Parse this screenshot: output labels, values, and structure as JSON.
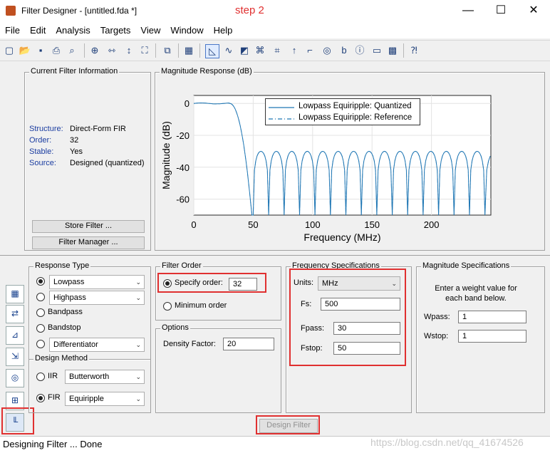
{
  "window": {
    "title": "Filter Designer -  [untitled.fda *]",
    "annotation": "step 2",
    "min": "—",
    "max": "☐",
    "close": "✕"
  },
  "menu": [
    "File",
    "Edit",
    "Analysis",
    "Targets",
    "View",
    "Window",
    "Help"
  ],
  "info": {
    "title": "Current Filter Information",
    "rows": [
      {
        "key": "Structure:",
        "value": "Direct-Form FIR"
      },
      {
        "key": "Order:",
        "value": "32"
      },
      {
        "key": "Stable:",
        "value": "Yes"
      },
      {
        "key": "Source:",
        "value": "Designed (quantized)"
      }
    ],
    "store_button": "Store Filter ...",
    "manager_button": "Filter Manager ..."
  },
  "plot": {
    "title": "Magnitude Response (dB)",
    "legend": [
      "Lowpass Equiripple: Quantized",
      "Lowpass Equiripple: Reference"
    ],
    "line_color": "#1f77b4"
  },
  "chart_data": {
    "type": "line",
    "xlabel": "Frequency (MHz)",
    "ylabel": "Magnitude (dB)",
    "xlim": [
      0,
      250
    ],
    "ylim": [
      -70,
      5
    ],
    "xticks": [
      0,
      50,
      100,
      150,
      200
    ],
    "yticks": [
      0,
      -20,
      -40,
      -60
    ],
    "passband_edge": 30,
    "stopband_edge": 50,
    "stopband_level": -30,
    "ripple_nulls": [
      50,
      63,
      76,
      89,
      102,
      115,
      128,
      141,
      154,
      167,
      180,
      193,
      206,
      219,
      232,
      245
    ],
    "series": [
      {
        "name": "Lowpass Equiripple: Quantized"
      },
      {
        "name": "Lowpass Equiripple: Reference"
      }
    ]
  },
  "response_type": {
    "title": "Response Type",
    "options": [
      {
        "label": "Lowpass",
        "selected": true,
        "dropdown": true
      },
      {
        "label": "Highpass",
        "selected": false,
        "dropdown": true
      },
      {
        "label": "Bandpass",
        "selected": false
      },
      {
        "label": "Bandstop",
        "selected": false
      },
      {
        "label": "Differentiator",
        "selected": false,
        "dropdown": true
      }
    ]
  },
  "design_method": {
    "title": "Design Method",
    "iir_label": "IIR",
    "iir_value": "Butterworth",
    "fir_label": "FIR",
    "fir_value": "Equiripple"
  },
  "filter_order": {
    "title": "Filter Order",
    "specify_label": "Specify order:",
    "specify_value": "32",
    "minimum_label": "Minimum order"
  },
  "options": {
    "title": "Options",
    "density_label": "Density Factor:",
    "density_value": "20"
  },
  "freq_specs": {
    "title": "Frequency Specifications",
    "units_label": "Units:",
    "units_value": "MHz",
    "fs_label": "Fs:",
    "fs_value": "500",
    "fpass_label": "Fpass:",
    "fpass_value": "30",
    "fstop_label": "Fstop:",
    "fstop_value": "50"
  },
  "mag_specs": {
    "title": "Magnitude Specifications",
    "hint": "Enter a weight value for each band below.",
    "wpass_label": "Wpass:",
    "wpass_value": "1",
    "wstop_label": "Wstop:",
    "wstop_value": "1"
  },
  "design_button": "Design Filter",
  "status": "Designing Filter ... Done",
  "watermark": "https://blog.csdn.net/qq_41674526"
}
